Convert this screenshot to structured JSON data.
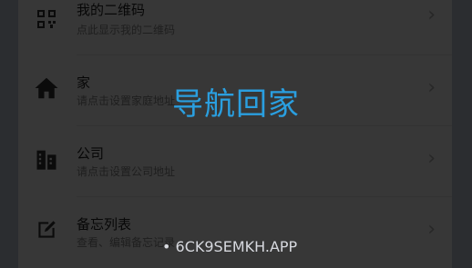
{
  "items": [
    {
      "title": "我的二维码",
      "subtitle": "点此显示我的二维码",
      "icon": "qr-code-icon"
    },
    {
      "title": "家",
      "subtitle": "请点击设置家庭地址",
      "icon": "home-icon"
    },
    {
      "title": "公司",
      "subtitle": "请点击设置公司地址",
      "icon": "office-building-icon"
    },
    {
      "title": "备忘列表",
      "subtitle": "查看、编辑备忘记录",
      "icon": "edit-note-icon"
    }
  ],
  "overlay": {
    "title": "导航回家"
  },
  "watermark": {
    "text": "• 6CK9SEMKH.APP"
  },
  "colors": {
    "accent": "#2a9fe0",
    "scrim": "rgba(0,0,0,0.78)",
    "background": "#c5cbdc"
  }
}
